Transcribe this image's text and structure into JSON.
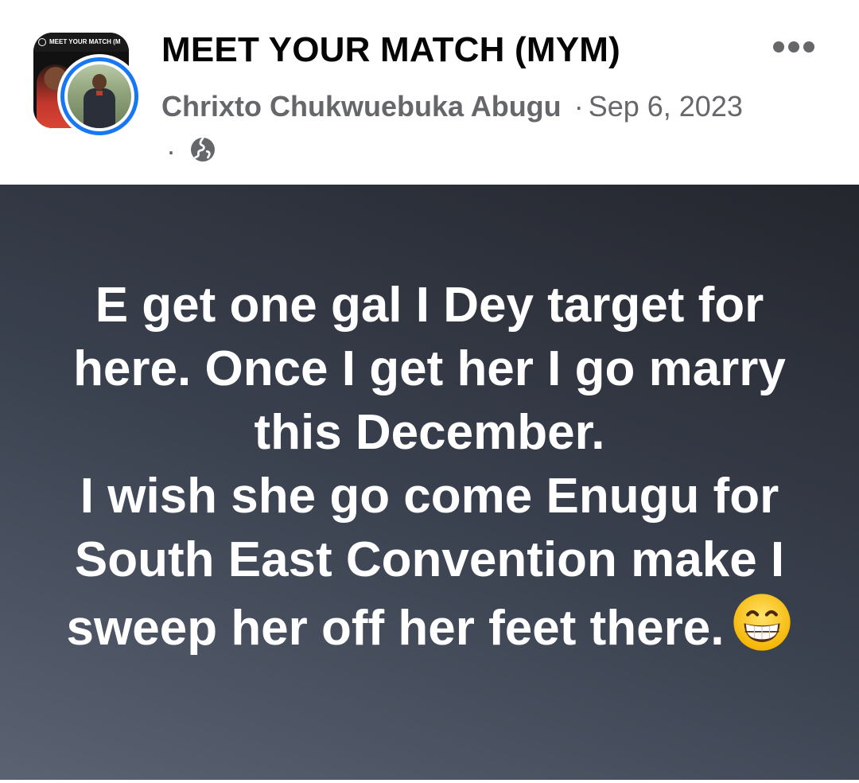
{
  "post": {
    "group_name": "MEET YOUR MATCH (MYM)",
    "author": "Chrixto Chukwuebuka Abugu",
    "date": "Sep 6, 2023",
    "separator": "·",
    "visibility_icon": "globe-icon",
    "more_icon": "more-options-icon"
  },
  "group_avatar": {
    "banner_text": "MEET YOUR MATCH (M"
  },
  "card": {
    "text": "E get one gal I Dey target for here. Once I get her I go marry this December.\nI wish she go come Enugu for South East Convention make I sweep her off her feet there.",
    "emoji": "grinning-face-with-smiling-eyes",
    "background_colors": [
      "#5b6373",
      "#3b4250",
      "#24262d"
    ]
  }
}
